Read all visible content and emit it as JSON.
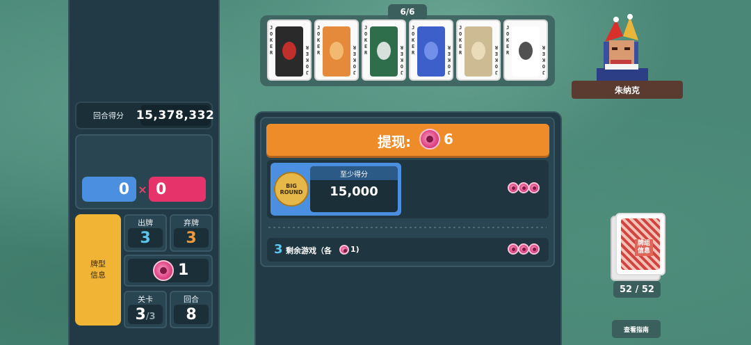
{
  "left_panel": {
    "round_score_label": "回合得分",
    "round_score_value": "15,378,332",
    "chips": "0",
    "times": "×",
    "mult": "0",
    "run_info_label": "牌型\n信息",
    "hands_label": "出牌",
    "hands_value": "3",
    "discards_label": "弃牌",
    "discards_value": "3",
    "money_value": "1",
    "ante_label": "关卡",
    "ante_value": "3",
    "ante_total": "/3",
    "round_label": "回合",
    "round_value": "8"
  },
  "jokers": {
    "count": "6/6",
    "cards": [
      {
        "label": "JOKER",
        "color": "#2a2a2a",
        "accent": "#d9302c"
      },
      {
        "label": "JOKER",
        "color": "#e48a3a",
        "accent": "#f3c27a"
      },
      {
        "label": "JOKER",
        "color": "#2f6e4a",
        "accent": "#f5f5f5"
      },
      {
        "label": "JOKER",
        "color": "#3d5fc9",
        "accent": "#7b98ef"
      },
      {
        "label": "JOKER",
        "color": "#cdbb94",
        "accent": "#efe2c0"
      },
      {
        "label": "JOKER",
        "color": "#ffffff",
        "accent": "#333333"
      }
    ]
  },
  "boss": {
    "name": "朱纳克"
  },
  "cash_out": {
    "label": "提现:",
    "value": "6",
    "blind_logo": "BIG\nROUND",
    "min_score_label": "至少得分",
    "min_score_value": "15,000",
    "remaining_hands_count": "3",
    "remaining_hands_label": "剩余游戏（各",
    "remaining_hands_each": "1)"
  },
  "deck": {
    "label": "牌组\n信息",
    "count": "52 / 52",
    "guide_label": "查看指南"
  },
  "colors": {
    "chips": "#4a8fe0",
    "mult": "#e6336a",
    "cashout": "#ef8c2a",
    "run_info": "#f1b434",
    "panel": "#213a46",
    "felt": "#4a8776"
  }
}
